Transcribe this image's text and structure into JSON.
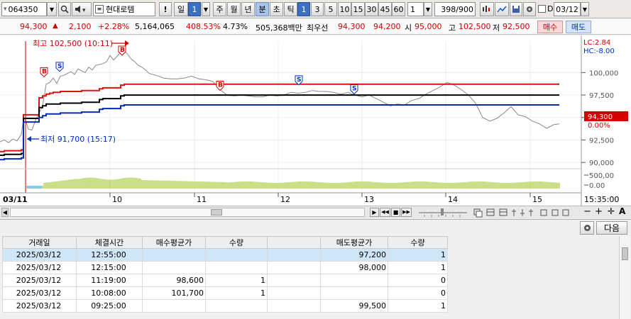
{
  "toolbar": {
    "code": "064350",
    "name": "현대로템",
    "periods": [
      "일",
      "1",
      "주",
      "월",
      "년",
      "분",
      "초",
      "틱"
    ],
    "minute_buttons": [
      "1",
      "3",
      "5",
      "10",
      "15",
      "30",
      "45",
      "60"
    ],
    "unit_value": "1",
    "count": "398",
    "count_total": "/900",
    "d_label": "D",
    "date": "03/12"
  },
  "quote": {
    "price": "94,300",
    "arrow": "▲",
    "change": "2,100",
    "change_pct": "+2.28%",
    "volume": "5,164,065",
    "volume_pct": "408.53%",
    "turnover_pct": "4.73%",
    "amount": "505,368백만",
    "best_label": "최우선",
    "best_ask": "94,300",
    "best_bid": "94,200",
    "open_label": "시",
    "open": "95,000",
    "high_label": "고",
    "high": "102,500",
    "low_label": "저",
    "low": "92,500",
    "buy_label": "매수",
    "sell_label": "매도"
  },
  "chart_labels": {
    "lc": "LC:2.84",
    "hc": "HC:-8.00",
    "current_price": "94,300",
    "current_pct": "0.00%",
    "high_note": "최고 102,500 (10:11)",
    "low_note": "최저 91,700 (15:17)",
    "yticks": [
      "100,000",
      "97,500",
      "95,000",
      "92,500",
      "90,000"
    ],
    "vol_ticks": [
      "500,00",
      "0.00"
    ],
    "date_label": "03/11",
    "xticks": [
      "10",
      "11",
      "12",
      "13",
      "14",
      "15"
    ],
    "time_label": "15:35:00"
  },
  "chart_data": {
    "type": "line",
    "title": "",
    "x": [
      0,
      6,
      12,
      18,
      24,
      30,
      33,
      36,
      40,
      45,
      50,
      55,
      60,
      65,
      70,
      75,
      80,
      85,
      90,
      95,
      100,
      105,
      110,
      115,
      120,
      125,
      130,
      135,
      140,
      145,
      150,
      155,
      160,
      165,
      170,
      175,
      180,
      185,
      190,
      195,
      200,
      205,
      210,
      220,
      230,
      240,
      250,
      260,
      270,
      280,
      290,
      300,
      310,
      320,
      330,
      340,
      350,
      360,
      370,
      380,
      390,
      400,
      410,
      420,
      430,
      440,
      450,
      460,
      470,
      480,
      490,
      500,
      510,
      520,
      530,
      540,
      550,
      560,
      570,
      580,
      590,
      600,
      610,
      620,
      630,
      640,
      650,
      660,
      670,
      680,
      690,
      700,
      710,
      720,
      730,
      740,
      750,
      760,
      770,
      780,
      788
    ],
    "series": [
      {
        "name": "price",
        "values": [
          92300,
          92500,
          92200,
          92600,
          92400,
          93100,
          94800,
          94700,
          93700,
          93600,
          94700,
          95500,
          96300,
          98700,
          98900,
          99400,
          98800,
          99600,
          99700,
          99900,
          100100,
          99800,
          100400,
          100200,
          100000,
          100600,
          100300,
          100800,
          100900,
          101000,
          101200,
          101900,
          101400,
          101800,
          102300,
          102500,
          102000,
          101500,
          101200,
          100800,
          100600,
          100300,
          99900,
          99700,
          99400,
          99300,
          99300,
          99400,
          99600,
          99300,
          99200,
          99000,
          98100,
          97500,
          97400,
          97500,
          97400,
          97300,
          97300,
          97500,
          97400,
          97500,
          97800,
          97700,
          97800,
          98000,
          97900,
          97900,
          97800,
          97600,
          97800,
          97500,
          97300,
          97500,
          97100,
          96700,
          96300,
          96500,
          96400,
          96900,
          97100,
          97600,
          98000,
          98400,
          98900,
          98600,
          98100,
          97500,
          96600,
          95000,
          94600,
          94900,
          95500,
          96200,
          95300,
          95100,
          94600,
          94300,
          93800,
          94200,
          94300
        ]
      },
      {
        "name": "upper",
        "values": [
          91200,
          91300,
          91300,
          91300,
          91300,
          91400,
          95300,
          95300,
          95300,
          95300,
          95300,
          97200,
          97400,
          97600,
          97700,
          97800,
          97800,
          97900,
          97900,
          97900,
          97900,
          97900,
          97900,
          98000,
          98000,
          98000,
          98000,
          98000,
          98200,
          98300,
          98300,
          98300,
          98300,
          98300,
          98600,
          98700,
          98700,
          98700,
          98700,
          98700,
          98700,
          98700,
          98700,
          98700,
          98700,
          98700,
          98700,
          98700,
          98700,
          98700,
          98700,
          98700,
          98700,
          98700,
          98700,
          98700,
          98700,
          98700,
          98700,
          98700,
          98700,
          98700,
          98700,
          98700,
          98700,
          98700,
          98700,
          98700,
          98700,
          98700,
          98700,
          98700,
          98700,
          98700,
          98700,
          98700,
          98700,
          98700,
          98700,
          98700,
          98700,
          98700,
          98700,
          98700,
          98700,
          98700,
          98700,
          98700,
          98700,
          98700,
          98700,
          98700,
          98700,
          98700,
          98700,
          98700,
          98700,
          98700,
          98700,
          98700,
          98700
        ]
      },
      {
        "name": "middle",
        "values": [
          90800,
          90900,
          90900,
          90900,
          90900,
          91000,
          94900,
          94900,
          94900,
          94900,
          94900,
          96100,
          96300,
          96500,
          96500,
          96500,
          96500,
          96600,
          96600,
          96600,
          96600,
          96600,
          96600,
          96700,
          96700,
          96700,
          96700,
          96700,
          97000,
          97100,
          97100,
          97100,
          97100,
          97100,
          97400,
          97500,
          97500,
          97500,
          97500,
          97500,
          97500,
          97500,
          97500,
          97500,
          97500,
          97500,
          97500,
          97500,
          97500,
          97500,
          97500,
          97500,
          97500,
          97500,
          97500,
          97500,
          97500,
          97500,
          97500,
          97500,
          97500,
          97500,
          97500,
          97500,
          97500,
          97500,
          97500,
          97500,
          97500,
          97500,
          97500,
          97500,
          97500,
          97500,
          97500,
          97500,
          97500,
          97500,
          97500,
          97500,
          97500,
          97500,
          97500,
          97500,
          97500,
          97500,
          97500,
          97500,
          97500,
          97500,
          97500,
          97500,
          97500,
          97500,
          97500,
          97500,
          97500,
          97500,
          97500,
          97500,
          97500
        ]
      },
      {
        "name": "lower",
        "values": [
          90300,
          90400,
          90400,
          90400,
          90400,
          90500,
          94500,
          94500,
          94500,
          94500,
          94500,
          95000,
          95200,
          95400,
          95400,
          95400,
          95400,
          95500,
          95500,
          95500,
          95500,
          95500,
          95500,
          95600,
          95600,
          95600,
          95600,
          95600,
          95900,
          96000,
          96000,
          96000,
          96000,
          96000,
          96300,
          96400,
          96400,
          96400,
          96400,
          96400,
          96400,
          96400,
          96400,
          96400,
          96400,
          96400,
          96400,
          96400,
          96400,
          96400,
          96400,
          96400,
          96400,
          96400,
          96400,
          96400,
          96400,
          96400,
          96400,
          96400,
          96400,
          96400,
          96400,
          96400,
          96400,
          96400,
          96400,
          96400,
          96400,
          96400,
          96400,
          96400,
          96400,
          96400,
          96400,
          96400,
          96400,
          96400,
          96400,
          96400,
          96400,
          96400,
          96400,
          96400,
          96400,
          96400,
          96400,
          96400,
          96400,
          96400,
          96400,
          96400,
          96400,
          96400,
          96400,
          96400,
          96400,
          96400,
          96400,
          96400,
          96400
        ]
      }
    ],
    "ylim": [
      89300,
      103500
    ],
    "colors": {
      "price": "#8a8a8a",
      "upper": "#d81414",
      "middle": "#000000",
      "lower": "#0a2ab0",
      "volume": "#a8c83a"
    },
    "signals": [
      {
        "label": "B",
        "x": 62,
        "v": 99600
      },
      {
        "label": "S",
        "x": 84,
        "v": 100200
      },
      {
        "label": "B",
        "x": 172,
        "v": 102000
      },
      {
        "label": "B",
        "x": 310,
        "v": 98100
      },
      {
        "label": "S",
        "x": 421,
        "v": 98700
      },
      {
        "label": "S",
        "x": 499,
        "v": 97700
      }
    ],
    "grid": true
  },
  "scroll_bar": {
    "play_buttons": [
      "▶",
      "◀◀",
      "■",
      "▶▶"
    ]
  },
  "grid_panel": {
    "next_label": "다음"
  },
  "trades": {
    "headers": [
      "거래일",
      "체결시간",
      "매수평균가",
      "수량",
      "",
      "매도평균가",
      "수량"
    ],
    "rows": [
      [
        "2025/03/12",
        "12:55:00",
        "",
        "",
        "",
        "97,200",
        "1"
      ],
      [
        "2025/03/12",
        "12:15:00",
        "",
        "",
        "",
        "98,000",
        "1"
      ],
      [
        "2025/03/12",
        "11:19:00",
        "98,600",
        "1",
        "",
        "",
        "0"
      ],
      [
        "2025/03/12",
        "10:08:00",
        "101,700",
        "1",
        "",
        "",
        "0"
      ],
      [
        "2025/03/12",
        "09:25:00",
        "",
        "",
        "",
        "99,500",
        "1"
      ]
    ]
  }
}
